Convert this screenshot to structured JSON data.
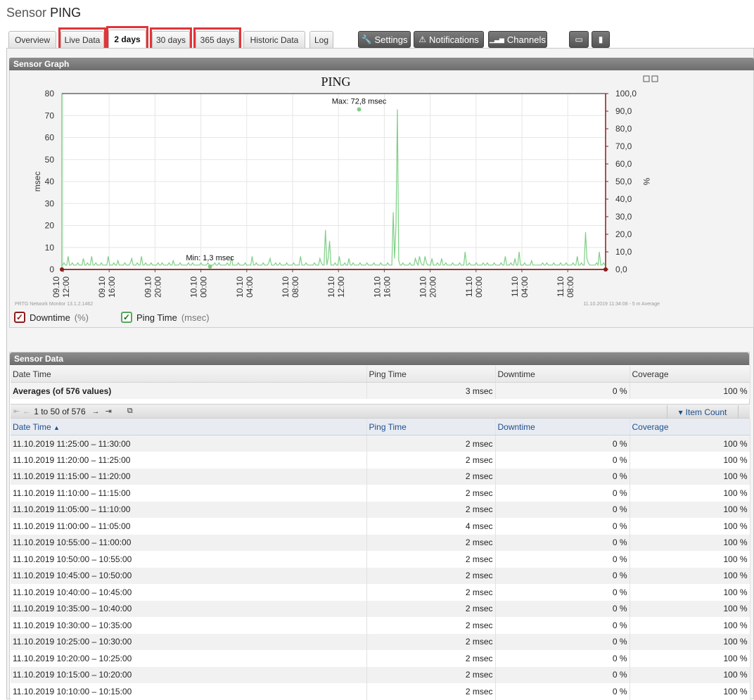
{
  "page": {
    "title_prefix": "Sensor",
    "title_name": "PING"
  },
  "tabs": [
    {
      "label": "Overview"
    },
    {
      "label": "Live Data"
    },
    {
      "label": "2 days"
    },
    {
      "label": "30 days"
    },
    {
      "label": "365 days"
    },
    {
      "label": "Historic Data"
    },
    {
      "label": "Log"
    }
  ],
  "toolbar": {
    "settings_label": "Settings",
    "notifications_label": "Notifications",
    "channels_label": "Channels",
    "settings_icon": "wrench-icon",
    "notifications_icon": "warning-icon",
    "channels_icon": "bars-icon"
  },
  "graph": {
    "panel_title": "Sensor Graph",
    "footer_left": "PRTG Network Monitor 13.1.2.1462",
    "footer_right": "11.10.2019 11:34:08 - 5 m Average",
    "legend": {
      "downtime_label": "Downtime",
      "downtime_unit": "(%)",
      "ping_label": "Ping Time",
      "ping_unit": "(msec)"
    }
  },
  "chart_data": {
    "type": "line",
    "title": "PING",
    "ylabel": "msec",
    "y2label": "%",
    "ylim": [
      0,
      80
    ],
    "y2lim": [
      0,
      100
    ],
    "yticks": [
      "0",
      "10",
      "20",
      "30",
      "40",
      "50",
      "60",
      "70",
      "80"
    ],
    "y2ticks": [
      "0,0",
      "10,0",
      "20,0",
      "30,0",
      "40,0",
      "50,0",
      "60,0",
      "70,0",
      "80,0",
      "90,0",
      "100,0"
    ],
    "xticks": [
      [
        "09.10",
        "12:00"
      ],
      [
        "09.10",
        "16:00"
      ],
      [
        "09.10",
        "20:00"
      ],
      [
        "10.10",
        "00:00"
      ],
      [
        "10.10",
        "04:00"
      ],
      [
        "10.10",
        "08:00"
      ],
      [
        "10.10",
        "12:00"
      ],
      [
        "10.10",
        "16:00"
      ],
      [
        "10.10",
        "20:00"
      ],
      [
        "11.10",
        "00:00"
      ],
      [
        "11.10",
        "04:00"
      ],
      [
        "11.10",
        "08:00"
      ]
    ],
    "grid": true,
    "annotations": [
      {
        "text": "Max: 72,8 msec",
        "x_hours": 26.5,
        "y": 72.8
      },
      {
        "text": "Min: 1,3 msec",
        "x_hours": 13.5,
        "y": 1.3
      }
    ],
    "series": [
      {
        "name": "Ping Time",
        "color": "#7fcf86",
        "values": [
          2,
          3,
          2,
          2,
          6,
          2,
          2,
          3,
          2,
          2,
          2,
          3,
          2,
          2,
          2,
          5,
          2,
          2,
          3,
          2,
          2,
          6,
          2,
          2,
          3,
          2,
          2,
          2,
          3,
          2,
          2,
          2,
          2,
          6,
          2,
          2,
          2,
          3,
          2,
          2,
          4,
          2,
          2,
          2,
          2,
          3,
          2,
          2,
          2,
          3,
          5,
          2,
          2,
          2,
          3,
          2,
          2,
          6,
          2,
          2,
          3,
          2,
          2,
          2,
          3,
          2,
          2,
          2,
          2,
          3,
          2,
          2,
          3,
          2,
          2,
          2,
          2,
          3,
          2,
          2,
          4,
          2,
          2,
          2,
          2,
          3,
          2,
          2,
          2,
          2,
          2,
          3,
          2,
          2,
          3,
          2,
          2,
          2,
          2,
          2,
          3,
          2,
          2,
          2,
          2,
          3,
          2,
          2,
          2,
          2,
          3,
          2,
          2,
          3,
          2,
          2,
          2,
          2,
          2,
          3,
          2,
          2,
          6,
          2,
          2,
          2,
          2,
          3,
          2,
          2,
          2,
          2,
          3,
          2,
          2,
          2,
          2,
          6,
          2,
          2,
          3,
          2,
          2,
          2,
          2,
          3,
          2,
          2,
          2,
          3,
          5,
          2,
          2,
          2,
          3,
          2,
          2,
          3,
          2,
          2,
          2,
          2,
          3,
          2,
          2,
          2,
          2,
          3,
          2,
          2,
          2,
          2,
          6,
          2,
          2,
          2,
          3,
          2,
          2,
          2,
          2,
          2,
          3,
          2,
          2,
          2,
          5,
          3,
          2,
          2,
          18,
          2,
          5,
          13,
          2,
          2,
          2,
          3,
          2,
          2,
          6,
          2,
          2,
          2,
          3,
          2,
          2,
          5,
          2,
          2,
          3,
          2,
          2,
          2,
          2,
          3,
          2,
          2,
          2,
          2,
          3,
          2,
          2,
          2,
          2,
          3,
          2,
          2,
          2,
          2,
          3,
          2,
          2,
          2,
          2,
          3,
          2,
          2,
          2,
          26,
          5,
          20,
          72.8,
          4,
          2,
          2,
          3,
          2,
          2,
          2,
          2,
          3,
          2,
          2,
          2,
          5,
          3,
          2,
          6,
          3,
          2,
          2,
          6,
          3,
          2,
          2,
          2,
          5,
          2,
          2,
          2,
          3,
          2,
          2,
          5,
          2,
          2,
          3,
          2,
          2,
          2,
          2,
          3,
          2,
          2,
          2,
          2,
          3,
          2,
          2,
          2,
          8,
          2,
          2,
          3,
          2,
          2,
          2,
          2,
          3,
          2,
          2,
          2,
          2,
          3,
          2,
          2,
          3,
          2,
          2,
          2,
          2,
          3,
          2,
          2,
          2,
          2,
          3,
          2,
          2,
          6,
          2,
          2,
          2,
          3,
          2,
          2,
          5,
          2,
          2,
          8,
          2,
          2,
          2,
          3,
          2,
          2,
          2,
          2,
          4,
          2,
          2,
          2,
          2,
          2,
          2,
          2,
          3,
          2,
          2,
          3,
          2,
          2,
          2,
          2,
          3,
          2,
          2,
          2,
          2,
          3,
          2,
          2,
          2,
          3,
          2,
          2,
          2,
          2,
          3,
          2,
          2,
          6,
          2,
          2,
          3,
          2,
          2,
          17,
          5,
          3,
          2,
          2,
          2,
          2,
          2,
          3,
          2,
          8,
          2,
          2,
          3,
          2
        ]
      },
      {
        "name": "Downtime",
        "color": "#8b1b1b",
        "values": [
          0
        ]
      }
    ]
  },
  "sensor_data": {
    "panel_title": "Sensor Data",
    "headers": {
      "date": "Date Time",
      "ping": "Ping Time",
      "downtime": "Downtime",
      "coverage": "Coverage"
    },
    "averages": {
      "label": "Averages (of 576 values)",
      "ping": "3 msec",
      "downtime": "0 %",
      "coverage": "100 %"
    },
    "pager_text": "1 to 50 of 576",
    "item_count_label": "Item Count",
    "columns": {
      "date": "Date Time",
      "ping": "Ping Time",
      "downtime": "Downtime",
      "coverage": "Coverage"
    },
    "rows": [
      {
        "date": "11.10.2019 11:25:00 – 11:30:00",
        "ping": "2 msec",
        "downtime": "0 %",
        "coverage": "100 %"
      },
      {
        "date": "11.10.2019 11:20:00 – 11:25:00",
        "ping": "2 msec",
        "downtime": "0 %",
        "coverage": "100 %"
      },
      {
        "date": "11.10.2019 11:15:00 – 11:20:00",
        "ping": "2 msec",
        "downtime": "0 %",
        "coverage": "100 %"
      },
      {
        "date": "11.10.2019 11:10:00 – 11:15:00",
        "ping": "2 msec",
        "downtime": "0 %",
        "coverage": "100 %"
      },
      {
        "date": "11.10.2019 11:05:00 – 11:10:00",
        "ping": "2 msec",
        "downtime": "0 %",
        "coverage": "100 %"
      },
      {
        "date": "11.10.2019 11:00:00 – 11:05:00",
        "ping": "4 msec",
        "downtime": "0 %",
        "coverage": "100 %"
      },
      {
        "date": "11.10.2019 10:55:00 – 11:00:00",
        "ping": "2 msec",
        "downtime": "0 %",
        "coverage": "100 %"
      },
      {
        "date": "11.10.2019 10:50:00 – 10:55:00",
        "ping": "2 msec",
        "downtime": "0 %",
        "coverage": "100 %"
      },
      {
        "date": "11.10.2019 10:45:00 – 10:50:00",
        "ping": "2 msec",
        "downtime": "0 %",
        "coverage": "100 %"
      },
      {
        "date": "11.10.2019 10:40:00 – 10:45:00",
        "ping": "2 msec",
        "downtime": "0 %",
        "coverage": "100 %"
      },
      {
        "date": "11.10.2019 10:35:00 – 10:40:00",
        "ping": "2 msec",
        "downtime": "0 %",
        "coverage": "100 %"
      },
      {
        "date": "11.10.2019 10:30:00 – 10:35:00",
        "ping": "2 msec",
        "downtime": "0 %",
        "coverage": "100 %"
      },
      {
        "date": "11.10.2019 10:25:00 – 10:30:00",
        "ping": "2 msec",
        "downtime": "0 %",
        "coverage": "100 %"
      },
      {
        "date": "11.10.2019 10:20:00 – 10:25:00",
        "ping": "2 msec",
        "downtime": "0 %",
        "coverage": "100 %"
      },
      {
        "date": "11.10.2019 10:15:00 – 10:20:00",
        "ping": "2 msec",
        "downtime": "0 %",
        "coverage": "100 %"
      },
      {
        "date": "11.10.2019 10:10:00 – 10:15:00",
        "ping": "2 msec",
        "downtime": "0 %",
        "coverage": "100 %"
      }
    ]
  }
}
